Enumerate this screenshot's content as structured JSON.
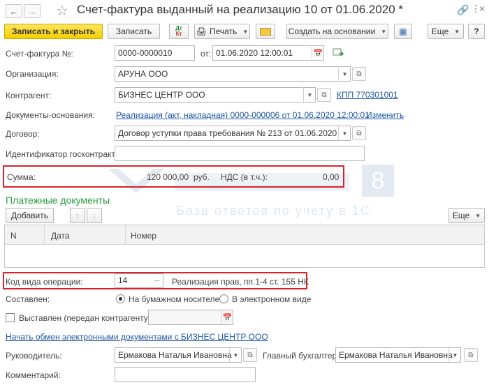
{
  "window": {
    "title": "Счет-фактура выданный на реализацию 10 от 01.06.2020 *"
  },
  "toolbar": {
    "save_close": "Записать и закрыть",
    "save": "Записать",
    "print": "Печать",
    "create_based": "Создать на основании",
    "more": "Еще"
  },
  "form": {
    "invoice_label": "Счет-фактура №:",
    "invoice_number": "0000-0000010",
    "date_label": "от:",
    "date_value": "01.06.2020 12:00:01",
    "org_label": "Организация:",
    "org_value": "АРУНА ООО",
    "counterparty_label": "Контрагент:",
    "counterparty_value": "БИЗНЕС ЦЕНТР ООО",
    "kpp_link": "КПП 770301001",
    "base_docs_label": "Документы-основания:",
    "base_docs_link": "Реализация (акт, накладная) 0000-000006 от 01.06.2020 12:00:01",
    "change_link": "Изменить",
    "contract_label": "Договор:",
    "contract_value": "Договор уступки права требования № 213 от 01.06.2020",
    "gov_id_label": "Идентификатор госконтракта:",
    "gov_id_value": "",
    "sum_label": "Сумма:",
    "sum_value": "120 000,00",
    "sum_currency": "руб.",
    "vat_label": "НДС (в т.ч.):",
    "vat_value": "0,00"
  },
  "payments": {
    "title": "Платежные документы",
    "add_button": "Добавить",
    "more": "Еще",
    "columns": [
      "N",
      "Дата",
      "Номер"
    ]
  },
  "operation": {
    "label": "Код вида операции:",
    "code": "14",
    "ellipsis": "...",
    "description": "Реализация прав, пп.1-4 ст. 155 НК"
  },
  "composed": {
    "label": "Составлен:",
    "paper": "На бумажном носителе",
    "electronic": "В электронном виде"
  },
  "issued": {
    "label": "Выставлен (передан контрагенту):",
    "value": ""
  },
  "edo_link": "Начать обмен электронными документами с БИЗНЕС ЦЕНТР ООО",
  "signers": {
    "head_label": "Руководитель:",
    "head_value": "Ермакова Наталья Ивановна",
    "accountant_label": "Главный бухгалтер:",
    "accountant_value": "Ермакова Наталья Ивановна"
  },
  "comment": {
    "label": "Комментарий:",
    "value": ""
  },
  "watermark": {
    "digit": "8",
    "subtitle": "База ответов по учету в 1С"
  }
}
